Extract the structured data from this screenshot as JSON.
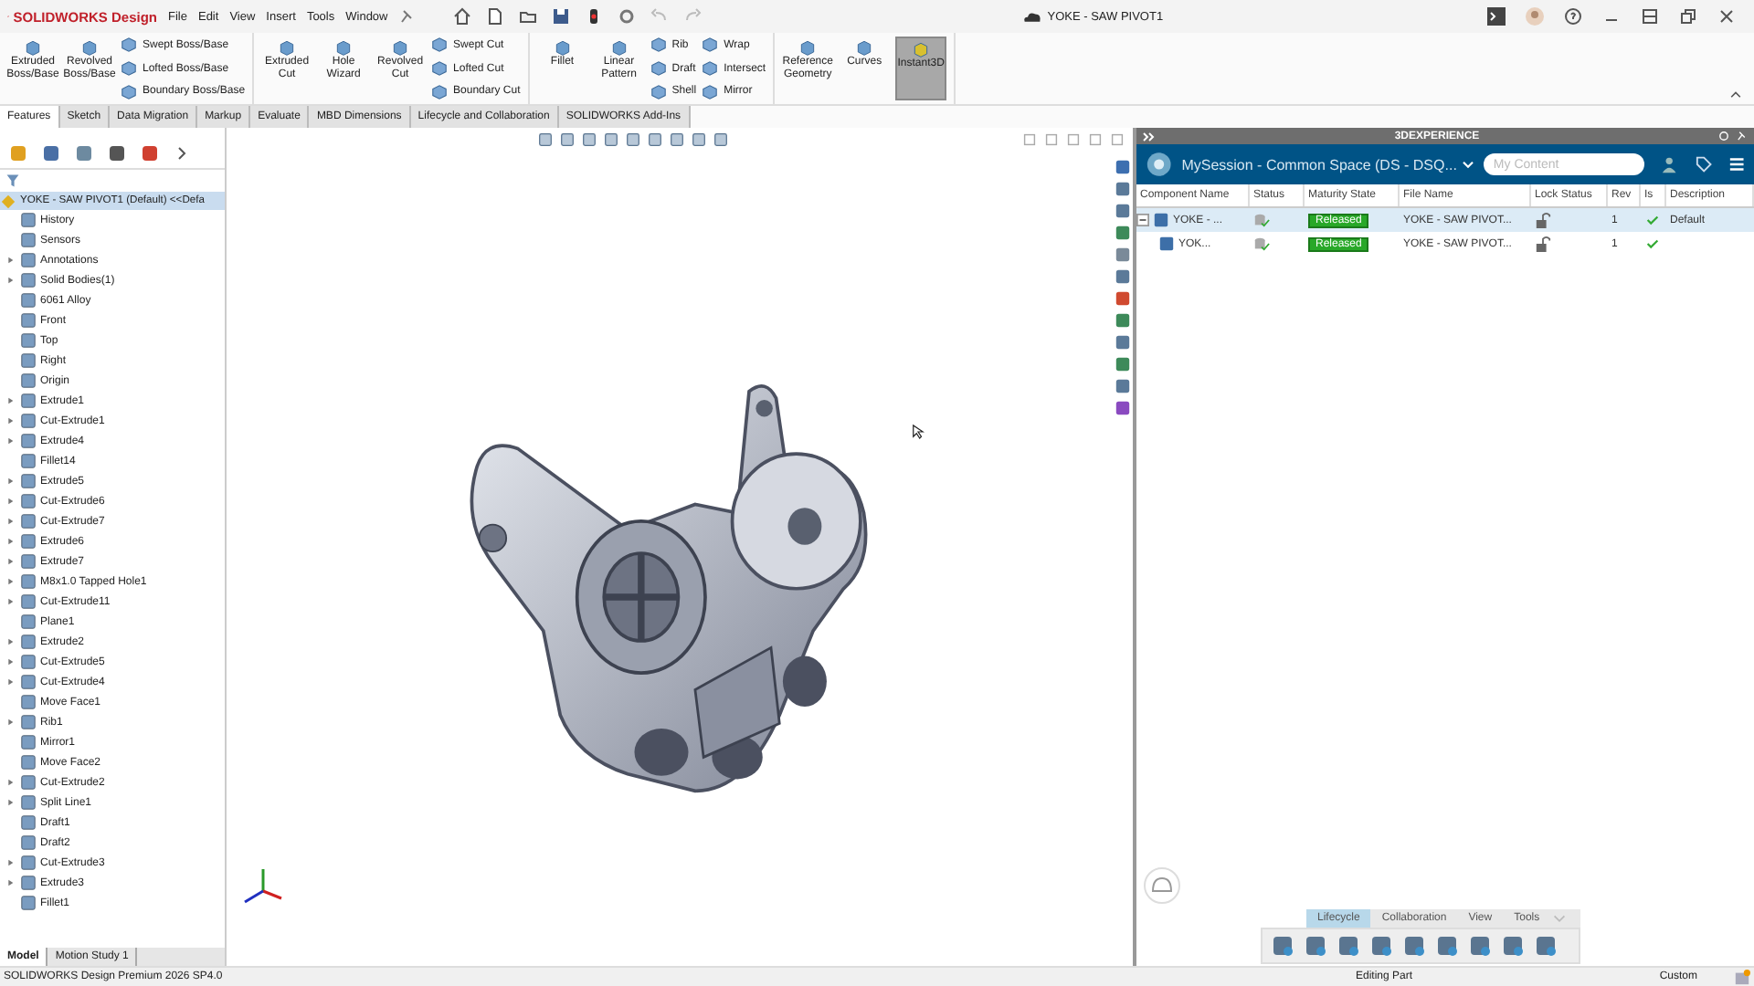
{
  "app": {
    "brand": "SOLIDWORKS Design",
    "document_title": "YOKE - SAW PIVOT1"
  },
  "menu": [
    "File",
    "Edit",
    "View",
    "Insert",
    "Tools",
    "Window"
  ],
  "ribbon": {
    "groups": [
      {
        "columns": [
          {
            "kind": "large",
            "label": "Extruded\nBoss/Base",
            "selected": false
          },
          {
            "kind": "large",
            "label": "Revolved\nBoss/Base",
            "selected": false
          },
          {
            "kind": "stack",
            "items": [
              "Swept Boss/Base",
              "Lofted Boss/Base",
              "Boundary Boss/Base"
            ]
          }
        ]
      },
      {
        "columns": [
          {
            "kind": "large",
            "label": "Extruded\nCut",
            "selected": false
          },
          {
            "kind": "large",
            "label": "Hole\nWizard",
            "selected": false
          },
          {
            "kind": "large",
            "label": "Revolved\nCut",
            "selected": false
          },
          {
            "kind": "stack",
            "items": [
              "Swept Cut",
              "Lofted Cut",
              "Boundary Cut"
            ]
          }
        ]
      },
      {
        "columns": [
          {
            "kind": "large",
            "label": "Fillet",
            "selected": false
          },
          {
            "kind": "large",
            "label": "Linear\nPattern",
            "selected": false
          },
          {
            "kind": "stack",
            "items": [
              "Rib",
              "Draft",
              "Shell"
            ]
          },
          {
            "kind": "stack",
            "items": [
              "Wrap",
              "Intersect",
              "Mirror"
            ]
          }
        ]
      },
      {
        "columns": [
          {
            "kind": "large",
            "label": "Reference\nGeometry",
            "selected": false
          },
          {
            "kind": "large",
            "label": "Curves",
            "selected": false
          },
          {
            "kind": "large",
            "label": "Instant3D",
            "selected": true
          }
        ]
      }
    ]
  },
  "tabs": [
    {
      "label": "Features",
      "selected": true
    },
    {
      "label": "Sketch",
      "selected": false
    },
    {
      "label": "Data Migration",
      "selected": false
    },
    {
      "label": "Markup",
      "selected": false
    },
    {
      "label": "Evaluate",
      "selected": false
    },
    {
      "label": "MBD Dimensions",
      "selected": false
    },
    {
      "label": "Lifecycle and Collaboration",
      "selected": false
    },
    {
      "label": "SOLIDWORKS Add-Ins",
      "selected": false
    }
  ],
  "feature_tree": {
    "root": "YOKE - SAW PIVOT1 (Default) <<Defa",
    "items": [
      {
        "label": "History",
        "collapsed": false
      },
      {
        "label": "Sensors",
        "collapsed": false
      },
      {
        "label": "Annotations",
        "collapsed": true
      },
      {
        "label": "Solid Bodies(1)",
        "collapsed": true
      },
      {
        "label": "6061 Alloy",
        "collapsed": false
      },
      {
        "label": "Front",
        "collapsed": false
      },
      {
        "label": "Top",
        "collapsed": false
      },
      {
        "label": "Right",
        "collapsed": false
      },
      {
        "label": "Origin",
        "collapsed": false
      },
      {
        "label": "Extrude1",
        "collapsed": true
      },
      {
        "label": "Cut-Extrude1",
        "collapsed": true
      },
      {
        "label": "Extrude4",
        "collapsed": true
      },
      {
        "label": "Fillet14",
        "collapsed": false
      },
      {
        "label": "Extrude5",
        "collapsed": true
      },
      {
        "label": "Cut-Extrude6",
        "collapsed": true
      },
      {
        "label": "Cut-Extrude7",
        "collapsed": true
      },
      {
        "label": "Extrude6",
        "collapsed": true
      },
      {
        "label": "Extrude7",
        "collapsed": true
      },
      {
        "label": "M8x1.0 Tapped Hole1",
        "collapsed": true
      },
      {
        "label": "Cut-Extrude11",
        "collapsed": true
      },
      {
        "label": "Plane1",
        "collapsed": false
      },
      {
        "label": "Extrude2",
        "collapsed": true
      },
      {
        "label": "Cut-Extrude5",
        "collapsed": true
      },
      {
        "label": "Cut-Extrude4",
        "collapsed": true
      },
      {
        "label": "Move Face1",
        "collapsed": false
      },
      {
        "label": "Rib1",
        "collapsed": true
      },
      {
        "label": "Mirror1",
        "collapsed": false
      },
      {
        "label": "Move Face2",
        "collapsed": false
      },
      {
        "label": "Cut-Extrude2",
        "collapsed": true
      },
      {
        "label": "Split Line1",
        "collapsed": true
      },
      {
        "label": "Draft1",
        "collapsed": false
      },
      {
        "label": "Draft2",
        "collapsed": false
      },
      {
        "label": "Cut-Extrude3",
        "collapsed": true
      },
      {
        "label": "Extrude3",
        "collapsed": true
      },
      {
        "label": "Fillet1",
        "collapsed": false
      }
    ]
  },
  "model_tabs": [
    {
      "label": "Model",
      "selected": true
    },
    {
      "label": "Motion Study 1",
      "selected": false
    }
  ],
  "experience_panel": {
    "title": "3DEXPERIENCE",
    "session": "MySession - Common Space (DS - DSQ...",
    "search": {
      "placeholder": "My Content"
    },
    "columns": [
      "Component Name",
      "Status",
      "Maturity State",
      "File Name",
      "Lock Status",
      "Rev",
      "Is",
      "Description"
    ],
    "rows": [
      {
        "name": "YOKE - ...",
        "maturity": "Released",
        "file": "YOKE - SAW PIVOT...",
        "rev": "1",
        "description": "Default",
        "selected": true,
        "expanded": true,
        "children": [
          {
            "name": "YOK...",
            "maturity": "Released",
            "file": "YOKE - SAW PIVOT...",
            "rev": "1",
            "selected": false
          }
        ]
      }
    ],
    "bottom_tabs": [
      {
        "label": "Lifecycle",
        "selected": true
      },
      {
        "label": "Collaboration",
        "selected": false
      },
      {
        "label": "View",
        "selected": false
      },
      {
        "label": "Tools",
        "selected": false
      }
    ]
  },
  "status_bar": {
    "product": "SOLIDWORKS Design Premium 2026 SP4.0",
    "mode": "Editing Part",
    "units": "Custom"
  }
}
